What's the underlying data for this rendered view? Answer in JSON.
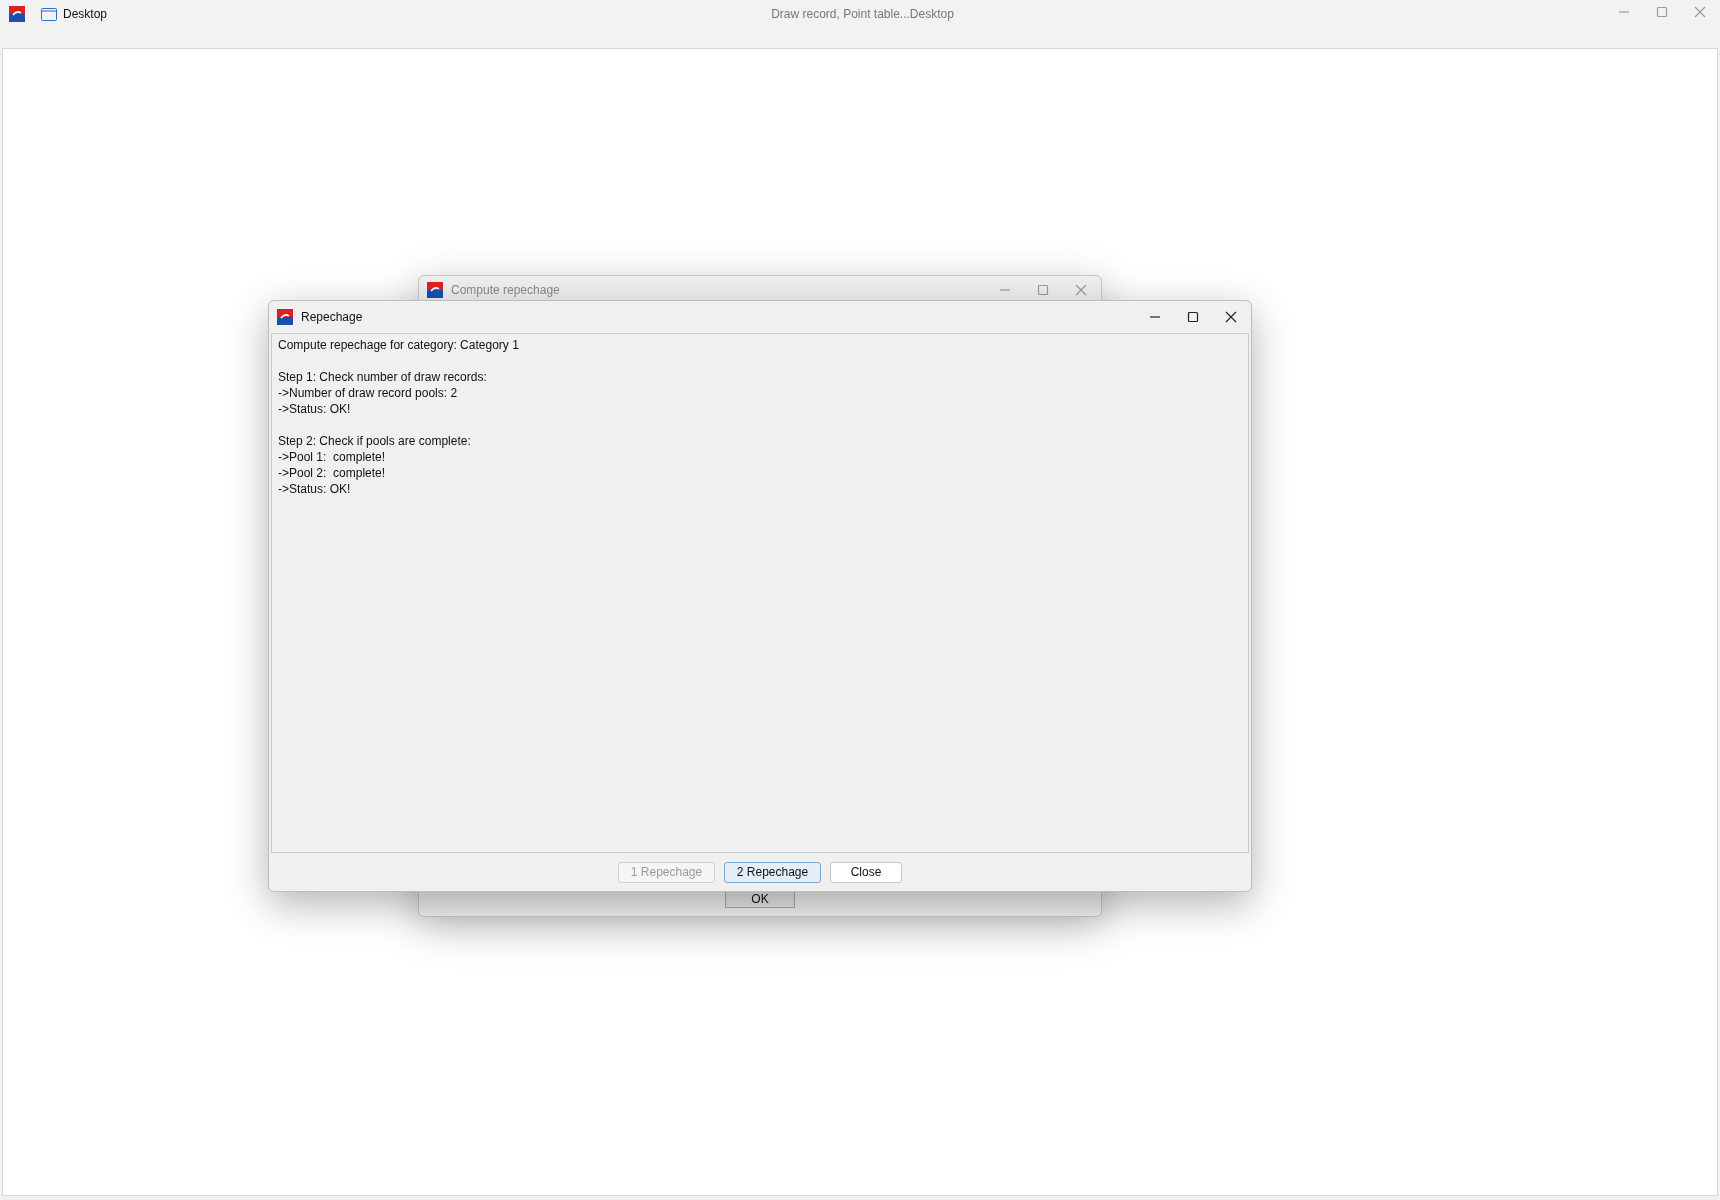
{
  "main_window": {
    "tab_label": "Desktop",
    "title": "Draw record, Point table...Desktop"
  },
  "back_dialog": {
    "title": "Compute repechage",
    "buttons": [
      {
        "label": "OK"
      }
    ]
  },
  "dialog": {
    "title": "Repechage",
    "paragraphs": [
      [
        "Compute repechage for category: Category 1"
      ],
      [
        "Step 1: Check number of draw records:",
        "->Number of draw record pools: 2",
        "->Status: OK!"
      ],
      [
        "Step 2: Check if pools are complete:",
        "->Pool 1:  complete!",
        "->Pool 2:  complete!",
        "->Status: OK!"
      ]
    ],
    "buttons": [
      {
        "label": "1 Repechage",
        "disabled": true,
        "default": false
      },
      {
        "label": "2 Repechage",
        "disabled": false,
        "default": true
      },
      {
        "label": "Close",
        "disabled": false,
        "default": false
      }
    ]
  }
}
